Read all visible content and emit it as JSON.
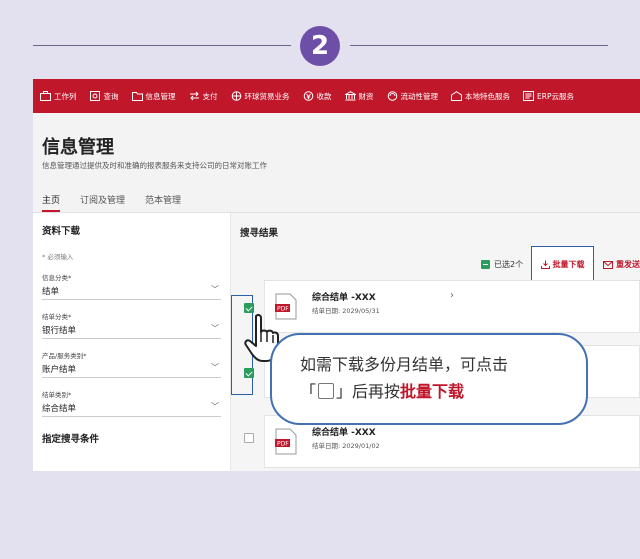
{
  "step": {
    "number": "2"
  },
  "nav": {
    "items": [
      {
        "label": "工作列",
        "icon": "briefcase-icon"
      },
      {
        "label": "查询",
        "icon": "search-doc-icon"
      },
      {
        "label": "信息管理",
        "icon": "folder-icon"
      },
      {
        "label": "支付",
        "icon": "transfer-icon"
      },
      {
        "label": "环球贸易业务",
        "icon": "globe-icon"
      },
      {
        "label": "收款",
        "icon": "money-icon"
      },
      {
        "label": "财资",
        "icon": "treasury-icon"
      },
      {
        "label": "流动性管理",
        "icon": "liquidity-icon"
      },
      {
        "label": "本地特色服务",
        "icon": "local-service-icon"
      },
      {
        "label": "ERP云服务",
        "icon": "cloud-icon"
      }
    ]
  },
  "header": {
    "title": "信息管理",
    "subtitle": "信息管理通过提供及时和准确的报表服务来支持公司的日常对账工作",
    "tabs": [
      "主页",
      "订阅及管理",
      "范本管理"
    ]
  },
  "filters": {
    "section_title": "资料下载",
    "required_note": "* 必须输入",
    "fields": [
      {
        "label": "信息分类*",
        "value": "结单"
      },
      {
        "label": "结单分类*",
        "value": "银行结单"
      },
      {
        "label": "产品/服务类别*",
        "value": "账户结单"
      },
      {
        "label": "结单类别*",
        "value": "综合结单"
      }
    ],
    "section_title2": "指定搜寻条件"
  },
  "results": {
    "title": "搜寻结果",
    "selected_label": "已选2个",
    "batch_download": "批量下载",
    "resend": "重发送",
    "items": [
      {
        "title": "综合结单 -XXX",
        "date": "结单日期:  2029/05/31",
        "checked": true
      },
      {
        "title": "",
        "date": "",
        "checked": true
      },
      {
        "title": "综合结单 -XXX",
        "date": "结单日期:  2029/01/02",
        "checked": false
      }
    ]
  },
  "callout": {
    "line1": "如需下载多份月结单，可点击",
    "open_bracket": "「",
    "close_bracket": "」后再按",
    "highlight": "批量下载"
  },
  "colors": {
    "brand": "#c0172b",
    "frame": "#2d5fa6",
    "check": "#2a9d5c",
    "step": "#6e4fa8"
  }
}
